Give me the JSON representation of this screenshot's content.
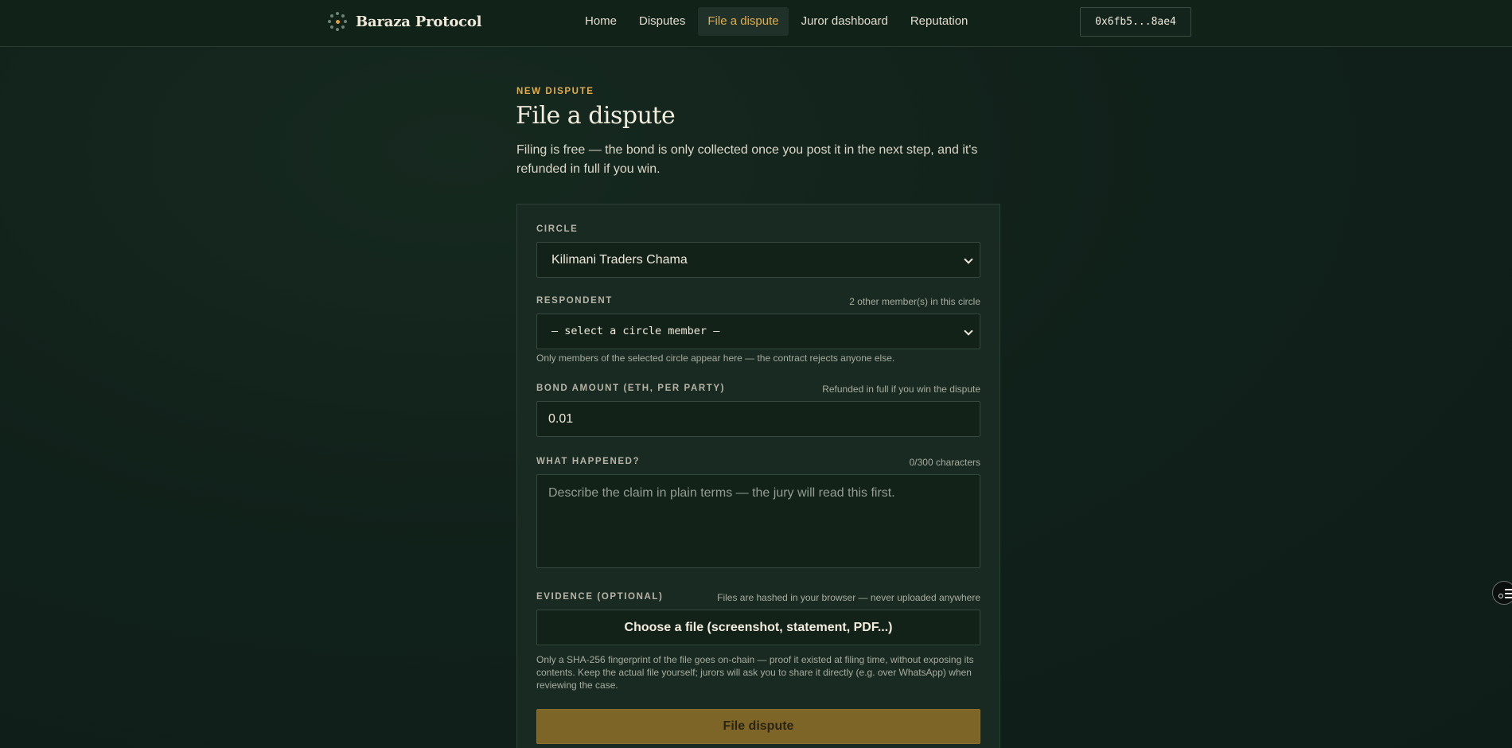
{
  "header": {
    "brand": "Baraza Protocol",
    "nav": [
      "Home",
      "Disputes",
      "File a dispute",
      "Juror dashboard",
      "Reputation"
    ],
    "active_nav": "File a dispute",
    "wallet": "0x6fb5...8ae4"
  },
  "page": {
    "eyebrow": "NEW DISPUTE",
    "title": "File a dispute",
    "subtitle": "Filing is free — the bond is only collected once you post it in the next step, and it's refunded in full if you win."
  },
  "form": {
    "circle": {
      "label": "CIRCLE",
      "value": "Kilimani Traders Chama"
    },
    "respondent": {
      "label": "RESPONDENT",
      "hint": "2 other member(s) in this circle",
      "value": "— select a circle member —",
      "help": "Only members of the selected circle appear here — the contract rejects anyone else."
    },
    "bond": {
      "label": "BOND AMOUNT (ETH, PER PARTY)",
      "hint": "Refunded in full if you win the dispute",
      "value": "0.01"
    },
    "what_happened": {
      "label": "WHAT HAPPENED?",
      "hint": "0/300 characters",
      "placeholder": "Describe the claim in plain terms — the jury will read this first."
    },
    "evidence": {
      "label": "EVIDENCE (OPTIONAL)",
      "hint": "Files are hashed in your browser — never uploaded anywhere",
      "button": "Choose a file (screenshot, statement, PDF...)",
      "help": "Only a SHA-256 fingerprint of the file goes on-chain — proof it existed at filing time, without exposing its contents. Keep the actual file yourself; jurors will ask you to share it directly (e.g. over WhatsApp) when reviewing the case."
    },
    "submit": "File dispute"
  },
  "colors": {
    "accent": "#e0ae4e",
    "background": "#112019",
    "submit": "#7d6528"
  }
}
